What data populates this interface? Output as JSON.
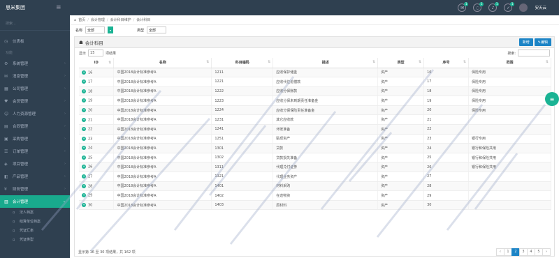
{
  "topbar": {
    "brand": "思米集团",
    "menu_icon": "menu-icon",
    "user": "安天云",
    "icons": [
      {
        "name": "mail-icon",
        "badge": "1"
      },
      {
        "name": "chat-icon",
        "badge": "1"
      },
      {
        "name": "bell-icon",
        "badge": "1"
      },
      {
        "name": "task-icon",
        "badge": "1"
      }
    ]
  },
  "sidebar": {
    "search": "搜索...",
    "items": [
      {
        "label": "仪表板",
        "icon": "dashboard-icon"
      },
      {
        "label": "系统管理",
        "icon": "settings-icon"
      },
      {
        "label": "消息管理",
        "icon": "message-icon"
      },
      {
        "label": "公司管理",
        "icon": "company-icon"
      },
      {
        "label": "会员管理",
        "icon": "member-icon"
      },
      {
        "label": "人力资源管理",
        "icon": "hr-icon"
      },
      {
        "label": "合同管理",
        "icon": "contract-icon"
      },
      {
        "label": "采购管理",
        "icon": "purchase-icon"
      },
      {
        "label": "订单管理",
        "icon": "order-icon"
      },
      {
        "label": "项目管理",
        "icon": "project-icon"
      },
      {
        "label": "产品管理",
        "icon": "product-icon"
      },
      {
        "label": "财务管理",
        "icon": "finance-icon"
      },
      {
        "label": "会计管理",
        "icon": "accounting-icon"
      }
    ],
    "heading": "功能",
    "subitems": [
      "法人档案",
      "结算单位档案",
      "凭证汇率",
      "凭证类型"
    ]
  },
  "breadcrumb": [
    "首页",
    "会计管理",
    "会计科目维护",
    "会计科目"
  ],
  "filters": {
    "label1": "名称",
    "value1": "全部",
    "label2": "类型",
    "value2": "全部"
  },
  "panel": {
    "title": "会计科目",
    "btn_new": "新增",
    "btn_edit": "编辑"
  },
  "tools": {
    "show": "显示",
    "per_page": "15",
    "unit": "项结果",
    "search": "搜索:"
  },
  "table": {
    "headers": [
      "ID",
      "名称",
      "科目编码",
      "描述",
      "类型",
      "序号",
      "范围"
    ],
    "rows": [
      [
        "16",
        "中国2018会计标准参考A",
        "1211",
        "应收保护储金",
        "资产",
        "16",
        "保险专用"
      ],
      [
        "17",
        "中国2018会计标准参考A",
        "1221",
        "应收代位追偿款",
        "资产",
        "17",
        "保险专用"
      ],
      [
        "18",
        "中国2018会计标准参考A",
        "1222",
        "应收分保账款",
        "资产",
        "18",
        "保险专用"
      ],
      [
        "19",
        "中国2018会计标准参考A",
        "1223",
        "应收分保未到期责任准备金",
        "资产",
        "19",
        "保险专用"
      ],
      [
        "20",
        "中国2018会计标准参考A",
        "1224",
        "应收分保保险责任准备金",
        "资产",
        "20",
        "保险专用"
      ],
      [
        "21",
        "中国2018会计标准参考A",
        "1231",
        "其它应收款",
        "资产",
        "21",
        ""
      ],
      [
        "22",
        "中国2018会计标准参考A",
        "1241",
        "坏账准备",
        "资产",
        "22",
        ""
      ],
      [
        "23",
        "中国2018会计标准参考A",
        "1251",
        "贴现资产",
        "资产",
        "23",
        "银行专用"
      ],
      [
        "24",
        "中国2018会计标准参考A",
        "1301",
        "贷款",
        "资产",
        "24",
        "银行和保险共用"
      ],
      [
        "25",
        "中国2018会计标准参考A",
        "1302",
        "贷款损失准备",
        "资产",
        "25",
        "银行和保险共用"
      ],
      [
        "26",
        "中国2018会计标准参考A",
        "1311",
        "代理兑付证券",
        "资产",
        "26",
        "银行和保险共用"
      ],
      [
        "27",
        "中国2018会计标准参考A",
        "1321",
        "代理业务资产",
        "资产",
        "27",
        ""
      ],
      [
        "28",
        "中国2018会计标准参考A",
        "1401",
        "材料采购",
        "资产",
        "28",
        ""
      ],
      [
        "29",
        "中国2018会计标准参考A",
        "1402",
        "在途物资",
        "资产",
        "29",
        ""
      ],
      [
        "30",
        "中国2018会计标准参考A",
        "1403",
        "原材料",
        "资产",
        "30",
        ""
      ]
    ]
  },
  "footer": {
    "info": "显示第 16 至 30 项结果，共 162 项",
    "pages": [
      "‹",
      "1",
      "2",
      "3",
      "4",
      "5",
      "›"
    ],
    "active": "2"
  },
  "colors": {
    "sidebar": "#2f4050",
    "accent": "#1ab394",
    "primary": "#1c84c6"
  }
}
